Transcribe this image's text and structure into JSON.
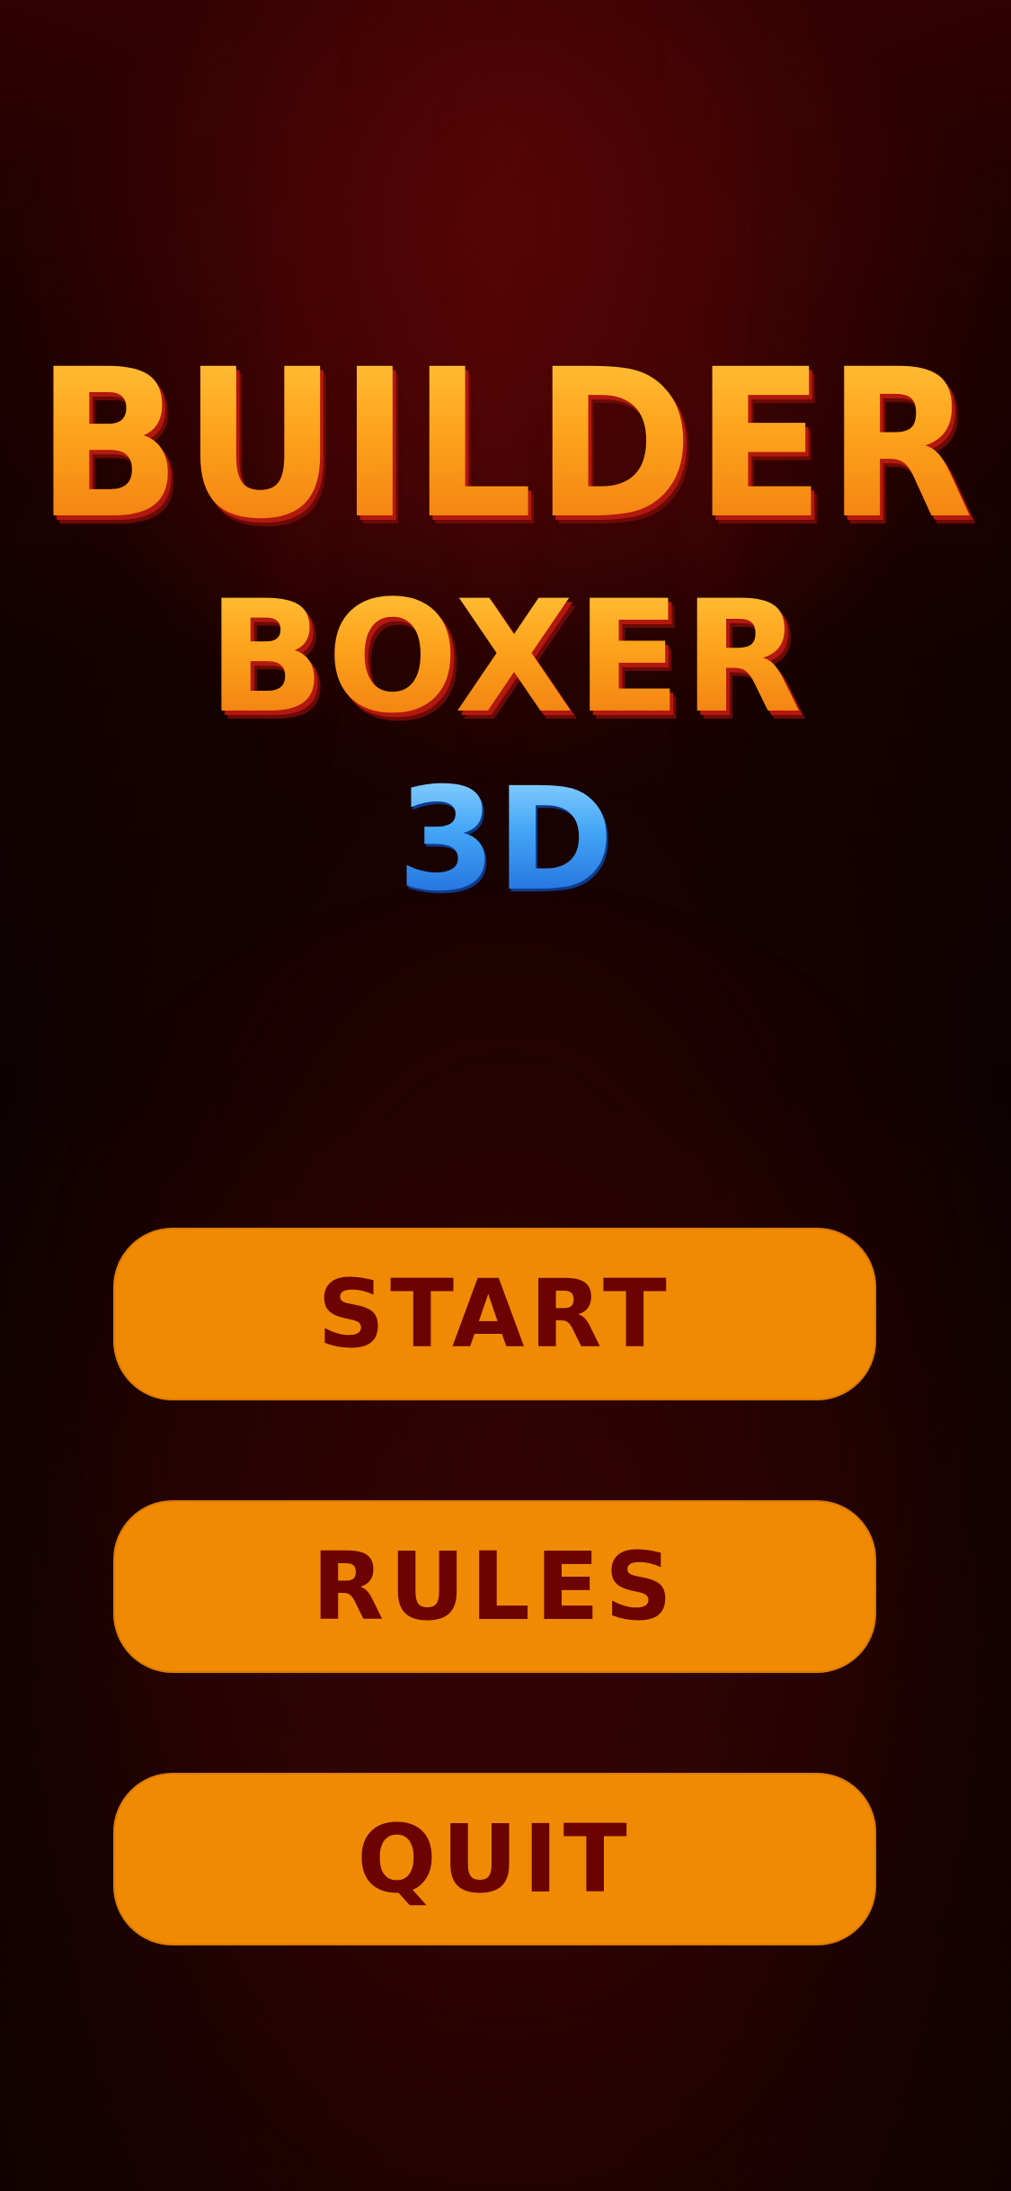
{
  "title": {
    "line1": "BUILDER",
    "line2": "BOXER",
    "line3": "3D"
  },
  "menu": {
    "start_label": "START",
    "rules_label": "RULES",
    "quit_label": "QUIT"
  },
  "colors": {
    "background": "#0d0101",
    "title_orange": "#fda21b",
    "title_blue": "#42a4f5",
    "button_fill": "#f08a03",
    "button_text": "#6b0303"
  }
}
